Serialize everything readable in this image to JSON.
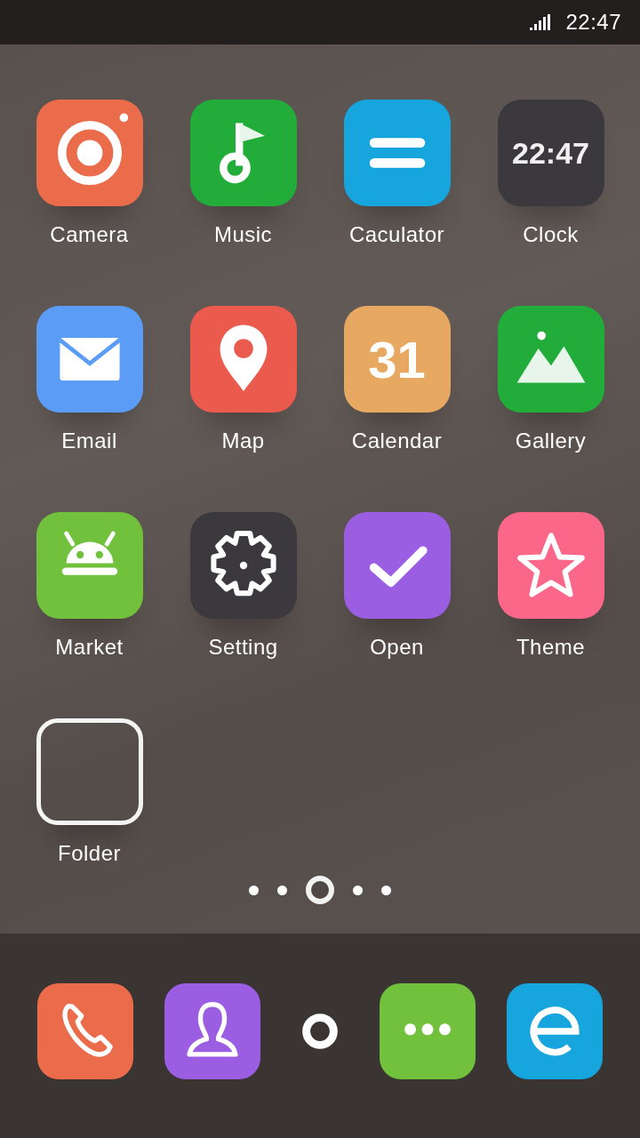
{
  "status_bar": {
    "time": "22:47"
  },
  "apps": [
    {
      "kind": "camera",
      "label": "Camera",
      "color": "#eb6c4b"
    },
    {
      "kind": "music",
      "label": "Music",
      "color": "#22ad3a"
    },
    {
      "kind": "calculator",
      "label": "Caculator",
      "color": "#17a5de"
    },
    {
      "kind": "clock",
      "label": "Clock",
      "color": "#3b393d",
      "time": "22:47"
    },
    {
      "kind": "email",
      "label": "Email",
      "color": "#5b9cf7"
    },
    {
      "kind": "map",
      "label": "Map",
      "color": "#ea5b4d"
    },
    {
      "kind": "calendar",
      "label": "Calendar",
      "color": "#e7a862",
      "date": "31"
    },
    {
      "kind": "gallery",
      "label": "Gallery",
      "color": "#22ad3a"
    },
    {
      "kind": "market",
      "label": "Market",
      "color": "#71c13c"
    },
    {
      "kind": "setting",
      "label": "Setting",
      "color": "#3b393d"
    },
    {
      "kind": "open",
      "label": "Open",
      "color": "#9b5ee3"
    },
    {
      "kind": "theme",
      "label": "Theme",
      "color": "#fb6789"
    },
    {
      "kind": "folder",
      "label": "Folder"
    }
  ],
  "page_dots": [
    {
      "selected": false
    },
    {
      "selected": false
    },
    {
      "selected": true
    },
    {
      "selected": false
    },
    {
      "selected": false
    }
  ],
  "dock": [
    {
      "kind": "phone",
      "color": "#eb6c4b"
    },
    {
      "kind": "contacts",
      "color": "#9b5ee3"
    },
    {
      "kind": "ring"
    },
    {
      "kind": "messages",
      "color": "#71c13c"
    },
    {
      "kind": "browser",
      "color": "#17a5de"
    }
  ]
}
